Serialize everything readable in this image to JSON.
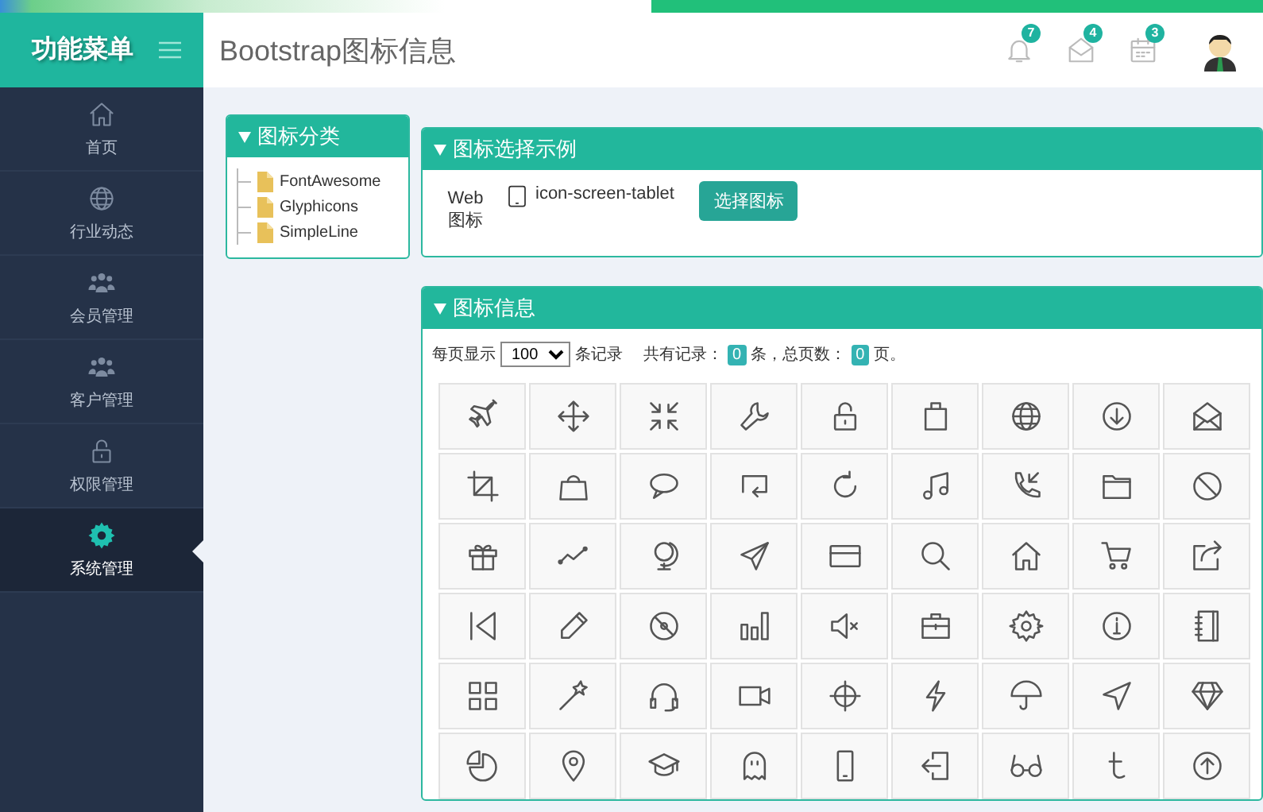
{
  "sidebar": {
    "title": "功能菜单",
    "items": [
      {
        "label": "首页",
        "kind": "home",
        "selected": false
      },
      {
        "label": "行业动态",
        "kind": "globe",
        "selected": false
      },
      {
        "label": "会员管理",
        "kind": "users",
        "selected": false
      },
      {
        "label": "客户管理",
        "kind": "users",
        "selected": false
      },
      {
        "label": "权限管理",
        "kind": "lock",
        "selected": false
      },
      {
        "label": "系统管理",
        "kind": "gear",
        "selected": true
      }
    ]
  },
  "header": {
    "title": "Bootstrap图标信息",
    "notifications": [
      {
        "kind": "bell",
        "count": "7"
      },
      {
        "kind": "mail",
        "count": "4"
      },
      {
        "kind": "calendar",
        "count": "3"
      }
    ]
  },
  "category_panel": {
    "title": "图标分类",
    "items": [
      "FontAwesome",
      "Glyphicons",
      "SimpleLine"
    ]
  },
  "example_panel": {
    "title": "图标选择示例",
    "label": "Web 图标",
    "value": "icon-screen-tablet",
    "button": "选择图标"
  },
  "info_panel": {
    "title": "图标信息",
    "page_size_label": "每页显示",
    "page_size": "100",
    "records_label": "条记录",
    "total_label": "共有记录：",
    "total": "0",
    "total_unit": "条，总页数：",
    "pages": "0",
    "pages_unit": "页。",
    "icons": [
      {
        "kind": "airplane"
      },
      {
        "kind": "move"
      },
      {
        "kind": "shrink"
      },
      {
        "kind": "wrench"
      },
      {
        "kind": "unlock"
      },
      {
        "kind": "bag"
      },
      {
        "kind": "globe"
      },
      {
        "kind": "down-circle"
      },
      {
        "kind": "envelope-open"
      },
      {
        "kind": "crop"
      },
      {
        "kind": "handbag"
      },
      {
        "kind": "bubble"
      },
      {
        "kind": "loop"
      },
      {
        "kind": "refresh"
      },
      {
        "kind": "music"
      },
      {
        "kind": "call-in"
      },
      {
        "kind": "folder"
      },
      {
        "kind": "ban"
      },
      {
        "kind": "gift"
      },
      {
        "kind": "graph"
      },
      {
        "kind": "desk-globe"
      },
      {
        "kind": "paper-plane"
      },
      {
        "kind": "credit-card"
      },
      {
        "kind": "search"
      },
      {
        "kind": "home"
      },
      {
        "kind": "cart"
      },
      {
        "kind": "share"
      },
      {
        "kind": "skip-back"
      },
      {
        "kind": "pencil"
      },
      {
        "kind": "disc"
      },
      {
        "kind": "bar-chart"
      },
      {
        "kind": "mute"
      },
      {
        "kind": "briefcase"
      },
      {
        "kind": "settings"
      },
      {
        "kind": "info"
      },
      {
        "kind": "notebook"
      },
      {
        "kind": "grid"
      },
      {
        "kind": "magic-wand"
      },
      {
        "kind": "headphones"
      },
      {
        "kind": "video-camera"
      },
      {
        "kind": "crosshair"
      },
      {
        "kind": "lightning"
      },
      {
        "kind": "umbrella"
      },
      {
        "kind": "cursor"
      },
      {
        "kind": "diamond"
      },
      {
        "kind": "pie-chart"
      },
      {
        "kind": "location-pin"
      },
      {
        "kind": "graduation-cap"
      },
      {
        "kind": "ghost"
      },
      {
        "kind": "phone"
      },
      {
        "kind": "login"
      },
      {
        "kind": "glasses"
      },
      {
        "kind": "t-logo"
      },
      {
        "kind": "up-circle"
      }
    ]
  }
}
